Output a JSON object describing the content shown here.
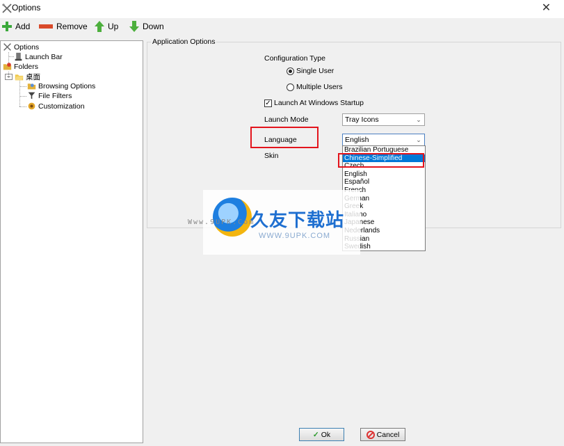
{
  "window": {
    "title": "Options",
    "close_glyph": "✕"
  },
  "toolbar": {
    "add_label": "Add",
    "remove_label": "Remove",
    "up_label": "Up",
    "down_label": "Down"
  },
  "tree": {
    "options": "Options",
    "launch_bar": "Launch Bar",
    "folders": "Folders",
    "desktop": "桌面",
    "browsing_options": "Browsing Options",
    "file_filters": "File Filters",
    "customization": "Customization"
  },
  "app_options": {
    "group_title": "Application Options",
    "configuration_type_label": "Configuration Type",
    "single_user_label": "Single User",
    "single_user_selected": true,
    "multiple_users_label": "Multiple Users",
    "launch_at_startup_label": "Launch At Windows Startup",
    "launch_at_startup_checked": true,
    "launch_mode_label": "Launch Mode",
    "launch_mode_value": "Tray Icons",
    "language_label": "Language",
    "language_value": "English",
    "skin_label": "Skin",
    "language_options": [
      "Brazilian Portuguese",
      "Chinese-Simplified",
      "Czech",
      "English",
      "Español",
      "French",
      "German",
      "Greek",
      "Italiano",
      "Japanese",
      "Nederlands",
      "Russian",
      "Swedish"
    ],
    "selected_option_index": 1
  },
  "watermark": {
    "brand_text": "久友下载站",
    "url_text": "WWW.9UPK.COM",
    "url_text_top": "Www.9UPK.Com"
  },
  "buttons": {
    "ok_label": "Ok",
    "cancel_label": "Cancel"
  },
  "colors": {
    "highlight": "#0078d7",
    "annotation_red": "#e3141c",
    "ok_border": "#3c7fb1"
  },
  "icons": [
    "options-icon",
    "close-icon",
    "add-icon",
    "remove-icon",
    "up-arrow-icon",
    "down-arrow-icon",
    "launch-bar-icon",
    "folders-icon",
    "desktop-folder-icon",
    "browsing-options-icon",
    "file-filters-icon",
    "customization-icon",
    "ok-check-icon",
    "cancel-icon",
    "dropdown-arrow-icon"
  ]
}
